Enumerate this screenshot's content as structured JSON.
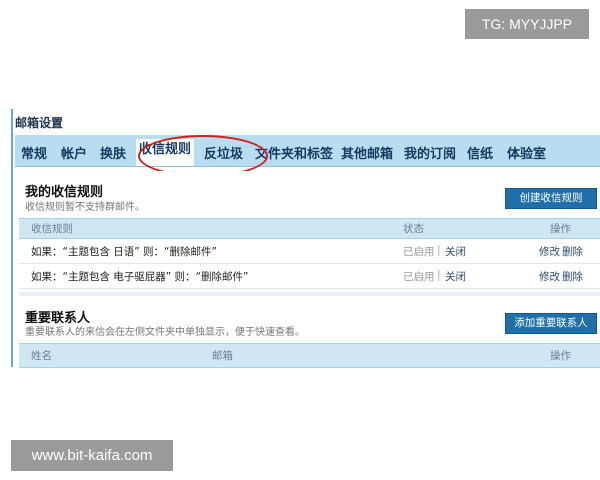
{
  "watermarks": {
    "tg": "TG: MYYJJPP",
    "site": "www.bit-kaifa.com"
  },
  "page_title": "邮箱设置",
  "tabs": [
    "常规",
    "帐户",
    "换肤",
    "收信规则",
    "反垃圾",
    "文件夹和标签",
    "其他邮箱",
    "我的订阅",
    "信纸",
    "体验室"
  ],
  "active_tab": "收信规则",
  "highlight_color": "#d0211c",
  "rules_section": {
    "title": "我的收信规则",
    "desc": "收信规则暂不支持群邮件。",
    "create_button": "创建收信规则",
    "headers": {
      "rule": "收信规则",
      "status": "状态",
      "action": "操作"
    },
    "rows": [
      {
        "rule": "如果：“主题包含 日语”   则：“删除邮件”",
        "status": "已启用",
        "toggle": "关闭",
        "edit": "修改",
        "delete": "删除"
      },
      {
        "rule": "如果：“主题包含 电子驱屁器”   则：“删除邮件”",
        "status": "已启用",
        "toggle": "关闭",
        "edit": "修改",
        "delete": "删除"
      }
    ]
  },
  "contacts_section": {
    "title": "重要联系人",
    "desc": "重要联系人的来信会在左侧文件夹中单独显示，便于快速查看。",
    "add_button": "添加重要联系人",
    "headers": {
      "name": "姓名",
      "email": "邮箱",
      "action": "操作"
    }
  }
}
